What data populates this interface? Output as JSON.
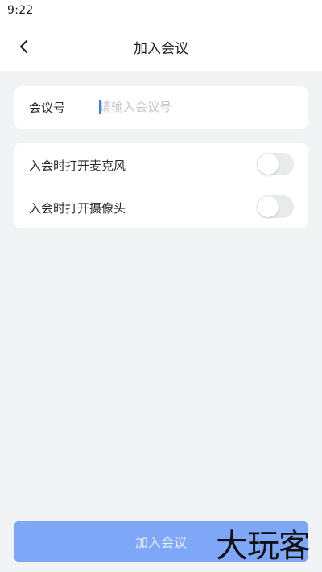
{
  "status_bar": {
    "time": "9:22"
  },
  "nav": {
    "title": "加入会议",
    "back_icon": "chevron-left-icon"
  },
  "meeting_id": {
    "label": "会议号",
    "placeholder": "请输入会议号",
    "value": ""
  },
  "options": [
    {
      "label": "入会时打开麦克风",
      "enabled": false
    },
    {
      "label": "入会时打开摄像头",
      "enabled": false
    }
  ],
  "join_button": {
    "label": "加入会议",
    "state": "disabled"
  },
  "watermark": {
    "text": "大玩客"
  },
  "colors": {
    "background": "#f2f3f5",
    "card": "#ffffff",
    "accent": "#3b7bff",
    "button_disabled": "#7ea7f8",
    "toggle_off": "#e9eaec"
  }
}
